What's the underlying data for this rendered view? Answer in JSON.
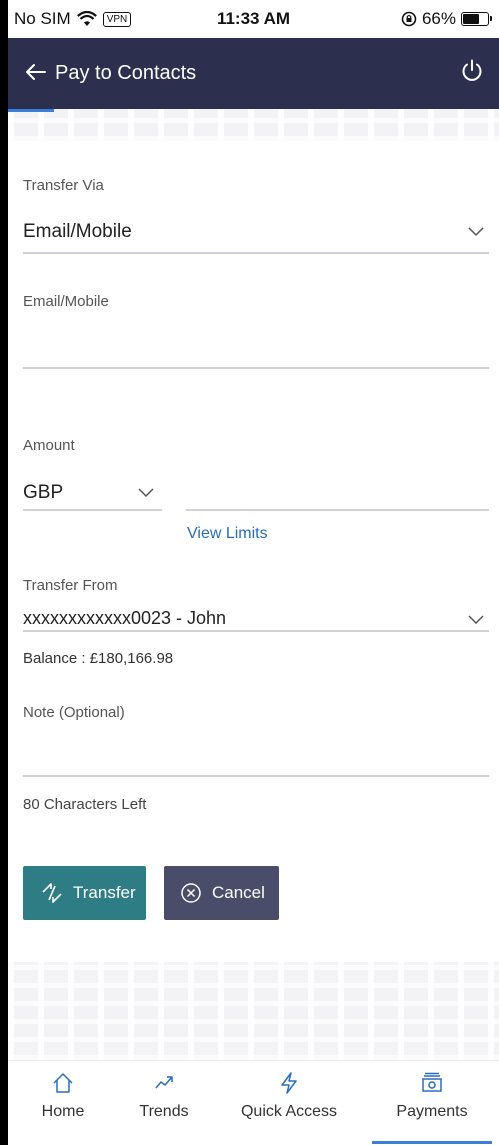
{
  "status_bar": {
    "carrier": "No SIM",
    "vpn": "VPN",
    "time": "11:33 AM",
    "battery": "66%",
    "battery_level": 0.66
  },
  "header": {
    "title": "Pay to Contacts"
  },
  "form": {
    "transfer_via": {
      "label": "Transfer Via",
      "value": "Email/Mobile"
    },
    "email_mobile": {
      "label": "Email/Mobile",
      "value": ""
    },
    "amount": {
      "label": "Amount",
      "currency": "GBP",
      "value": "",
      "view_limits": "View Limits"
    },
    "transfer_from": {
      "label": "Transfer From",
      "value": "xxxxxxxxxxxx0023 - John",
      "balance": "Balance : £180,166.98"
    },
    "note": {
      "label": "Note (Optional)",
      "value": "",
      "chars_left": "80 Characters Left"
    }
  },
  "buttons": {
    "transfer": "Transfer",
    "cancel": "Cancel"
  },
  "tabs": [
    {
      "label": "Home",
      "icon": "home-icon"
    },
    {
      "label": "Trends",
      "icon": "trends-icon"
    },
    {
      "label": "Quick Access",
      "icon": "lightning-icon"
    },
    {
      "label": "Payments",
      "icon": "payments-icon",
      "active": true
    }
  ],
  "colors": {
    "header": "#2c2f4d",
    "transfer_button": "#2e7d84",
    "cancel_button": "#4a4d6a",
    "link": "#2a6db8",
    "active_tab": "#3b7dd8"
  }
}
